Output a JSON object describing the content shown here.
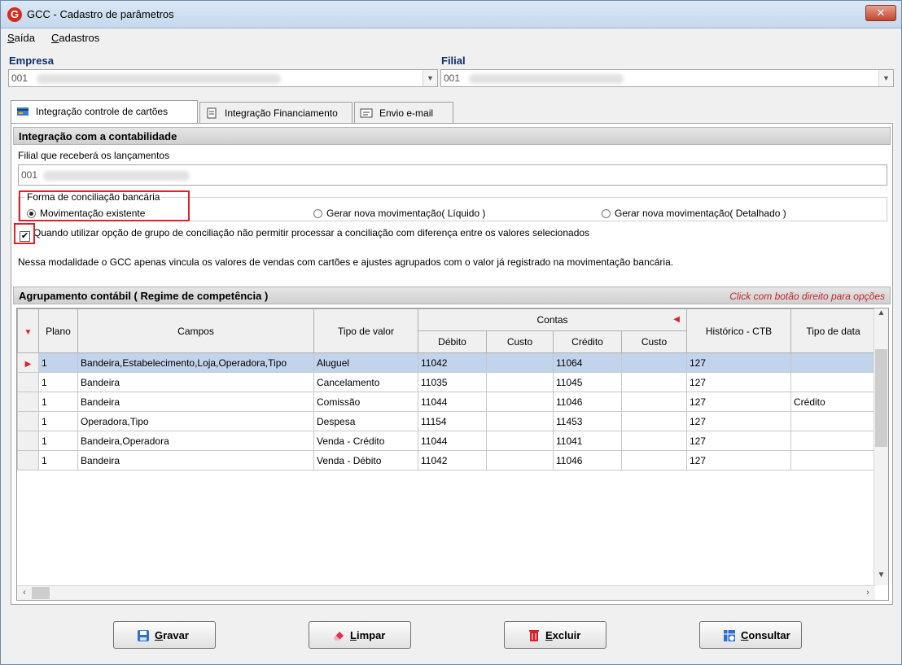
{
  "window": {
    "title": "GCC - Cadastro de parâmetros",
    "app_icon_glyph": "G",
    "close_glyph": "✕"
  },
  "menu": [
    {
      "accel": "S",
      "rest": "aída"
    },
    {
      "accel": "C",
      "rest": "adastros"
    }
  ],
  "empresa": {
    "label": "Empresa",
    "value": "001"
  },
  "filial": {
    "label": "Filial",
    "value": "001"
  },
  "tabs": [
    {
      "label": "Integração controle de cartões",
      "icon": "card-tab-icon",
      "active": true
    },
    {
      "label": "Integração Financiamento",
      "icon": "document-tab-icon",
      "active": false
    },
    {
      "label": "Envio e-mail",
      "icon": "mail-tab-icon",
      "active": false
    }
  ],
  "contab": {
    "header": "Integração com a contabilidade",
    "filial_label": "Filial que receberá os lançamentos",
    "filial_value": "001",
    "group_title": "Forma de conciliação bancária",
    "radios": [
      {
        "label": "Movimentação existente",
        "checked": true
      },
      {
        "label": "Gerar nova movimentação( Líquido )",
        "checked": false
      },
      {
        "label": "Gerar nova movimentação( Detalhado )",
        "checked": false
      }
    ],
    "checkbox_label": "Quando utilizar opção de grupo de conciliação não permitir processar a conciliação com diferença entre os valores selecionados",
    "checkbox_checked": true,
    "note": "Nessa modalidade o GCC apenas vincula os valores de vendas com cartões e ajustes agrupados com o valor já registrado na movimentação bancária."
  },
  "agrupamento": {
    "header": "Agrupamento contábil ( Regime de competência )",
    "hint": "Click com botão direito para opções",
    "columns": {
      "plano": "Plano",
      "campos": "Campos",
      "tipo_valor": "Tipo de valor",
      "contas": "Contas",
      "debito": "Débito",
      "custo1": "Custo",
      "credito": "Crédito",
      "custo2": "Custo",
      "historico": "Histórico - CTB",
      "tipo_data": "Tipo de data"
    },
    "rows": [
      {
        "plano": "1",
        "campos": "Bandeira,Estabelecimento,Loja,Operadora,Tipo",
        "tipo_valor": "Aluguel",
        "debito": "11042",
        "custo1": "",
        "credito": "11064",
        "custo2": "",
        "historico": "127",
        "tipo_data": "",
        "selected": true
      },
      {
        "plano": "1",
        "campos": "Bandeira",
        "tipo_valor": "Cancelamento",
        "debito": "11035",
        "custo1": "",
        "credito": "11045",
        "custo2": "",
        "historico": "127",
        "tipo_data": ""
      },
      {
        "plano": "1",
        "campos": "Bandeira",
        "tipo_valor": "Comissão",
        "debito": "11044",
        "custo1": "",
        "credito": "11046",
        "custo2": "",
        "historico": "127",
        "tipo_data": "Crédito"
      },
      {
        "plano": "1",
        "campos": "Operadora,Tipo",
        "tipo_valor": "Despesa",
        "debito": "11154",
        "custo1": "",
        "credito": "11453",
        "custo2": "",
        "historico": "127",
        "tipo_data": ""
      },
      {
        "plano": "1",
        "campos": "Bandeira,Operadora",
        "tipo_valor": "Venda - Crédito",
        "debito": "11044",
        "custo1": "",
        "credito": "11041",
        "custo2": "",
        "historico": "127",
        "tipo_data": ""
      },
      {
        "plano": "1",
        "campos": "Bandeira",
        "tipo_valor": "Venda - Débito",
        "debito": "11042",
        "custo1": "",
        "credito": "11046",
        "custo2": "",
        "historico": "127",
        "tipo_data": ""
      }
    ]
  },
  "buttons": [
    {
      "name": "gravar-button",
      "accel": "G",
      "rest": "ravar",
      "icon": "save-icon",
      "color": "#2f6fd0"
    },
    {
      "name": "limpar-button",
      "accel": "L",
      "rest": "impar",
      "icon": "eraser-icon",
      "color": "#e0304a"
    },
    {
      "name": "excluir-button",
      "accel": "E",
      "rest": "xcluir",
      "icon": "trash-icon",
      "color": "#d4202a"
    },
    {
      "name": "consultar-button",
      "accel": "C",
      "rest": "onsultar",
      "icon": "search-grid-icon",
      "color": "#2f6fd0"
    }
  ]
}
